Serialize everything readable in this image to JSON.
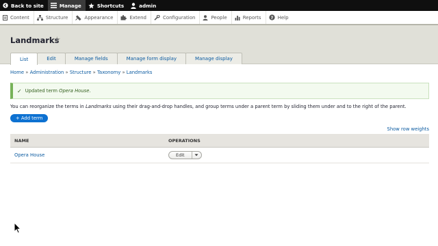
{
  "toolbar": {
    "back_to_site": "Back to site",
    "manage": "Manage",
    "shortcuts": "Shortcuts",
    "user": "admin"
  },
  "admin_menu": {
    "items": [
      {
        "label": "Content",
        "icon": "content-icon"
      },
      {
        "label": "Structure",
        "icon": "structure-icon"
      },
      {
        "label": "Appearance",
        "icon": "appearance-icon"
      },
      {
        "label": "Extend",
        "icon": "extend-icon"
      },
      {
        "label": "Configuration",
        "icon": "configuration-icon"
      },
      {
        "label": "People",
        "icon": "people-icon"
      },
      {
        "label": "Reports",
        "icon": "reports-icon"
      },
      {
        "label": "Help",
        "icon": "help-icon"
      }
    ]
  },
  "page": {
    "title": "Landmarks",
    "tabs": [
      "List",
      "Edit",
      "Manage fields",
      "Manage form display",
      "Manage display"
    ],
    "active_tab": "List"
  },
  "breadcrumb": {
    "items": [
      "Home",
      "Administration",
      "Structure",
      "Taxonomy",
      "Landmarks"
    ],
    "separator": "»"
  },
  "status": {
    "prefix": "Updated term ",
    "term": "Opera House",
    "suffix": "."
  },
  "help": {
    "before": "You can reorganize the terms in ",
    "vocab": "Landmarks",
    "after": " using their drag-and-drop handles, and group terms under a parent term by sliding them under and to the right of the parent."
  },
  "actions": {
    "add_term": "+ Add term",
    "show_row_weights": "Show row weights"
  },
  "table": {
    "headers": {
      "name": "NAME",
      "operations": "OPERATIONS"
    },
    "rows": [
      {
        "name": "Opera House",
        "operation": "Edit"
      }
    ]
  },
  "colors": {
    "toolbar_bg": "#0f0f0f",
    "header_bg": "#e0e0d8",
    "link": "#0a5aa0",
    "primary_button": "#0d71d1",
    "status_border": "#77b259"
  }
}
